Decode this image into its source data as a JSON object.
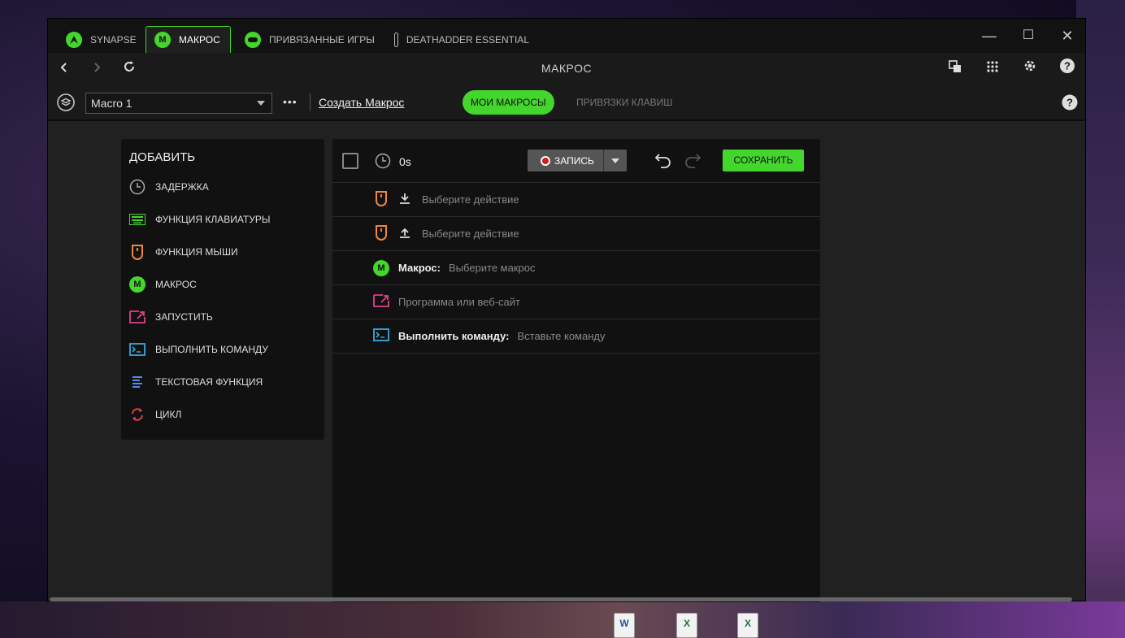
{
  "tabs": [
    {
      "label": "SYNAPSE",
      "icon": "razer-snake-icon",
      "active": false
    },
    {
      "label": "МАКРОС",
      "icon": "macro-m-icon",
      "badge": "M",
      "active": true
    },
    {
      "label": "ПРИВЯЗАННЫЕ ИГРЫ",
      "icon": "gamepad-icon",
      "active": false
    },
    {
      "label": "DEATHADDER ESSENTIAL",
      "icon": "mouse-icon",
      "active": false
    }
  ],
  "navbar": {
    "title": "МАКРОС"
  },
  "toolbar": {
    "macro_selected": "Macro 1",
    "more_label": "•••",
    "create_link": "Создать Макрос",
    "tab_my_macros": "МОИ МАКРОСЫ",
    "tab_key_bindings": "ПРИВЯЗКИ КЛАВИШ"
  },
  "add_panel": {
    "title": "ДОБАВИТЬ",
    "items": [
      {
        "label": "ЗАДЕРЖКА",
        "icon": "clock-icon"
      },
      {
        "label": "ФУНКЦИЯ КЛАВИАТУРЫ",
        "icon": "keyboard-icon"
      },
      {
        "label": "ФУНКЦИЯ МЫШИ",
        "icon": "mouse-icon"
      },
      {
        "label": "МАКРОС",
        "icon": "macro-m-icon",
        "badge": "M"
      },
      {
        "label": "ЗАПУСТИТЬ",
        "icon": "launch-icon"
      },
      {
        "label": "ВЫПОЛНИТЬ КОМАНДУ",
        "icon": "terminal-icon"
      },
      {
        "label": "ТЕКСТОВАЯ ФУНКЦИЯ",
        "icon": "text-icon"
      },
      {
        "label": "ЦИКЛ",
        "icon": "loop-icon"
      }
    ]
  },
  "editor": {
    "duration": "0s",
    "record_label": "ЗАПИСЬ",
    "save_label": "СОХРАНИТЬ",
    "rows": [
      {
        "placeholder": "Выберите действие",
        "icon": "mouse-icon",
        "sub_icon": "download-arrow-icon"
      },
      {
        "placeholder": "Выберите действие",
        "icon": "mouse-icon",
        "sub_icon": "upload-arrow-icon"
      },
      {
        "label": "Макрос:",
        "placeholder": "Выберите макрос",
        "icon": "macro-m-icon",
        "badge": "M"
      },
      {
        "placeholder": "Программа или веб-сайт",
        "icon": "launch-icon"
      },
      {
        "label": "Выполнить команду:",
        "placeholder": "Вставьте команду",
        "icon": "terminal-icon"
      }
    ]
  },
  "window_controls": {
    "minimize": "—",
    "maximize": "☐",
    "close": "✕"
  },
  "colors": {
    "accent": "#44d62c",
    "mouse": "#f0883a",
    "launch": "#e0408a",
    "terminal": "#3aa8e0",
    "text_fn": "#5a8ae8",
    "loop": "#e04040"
  },
  "desktop_icons": [
    "W",
    "X",
    "X"
  ]
}
